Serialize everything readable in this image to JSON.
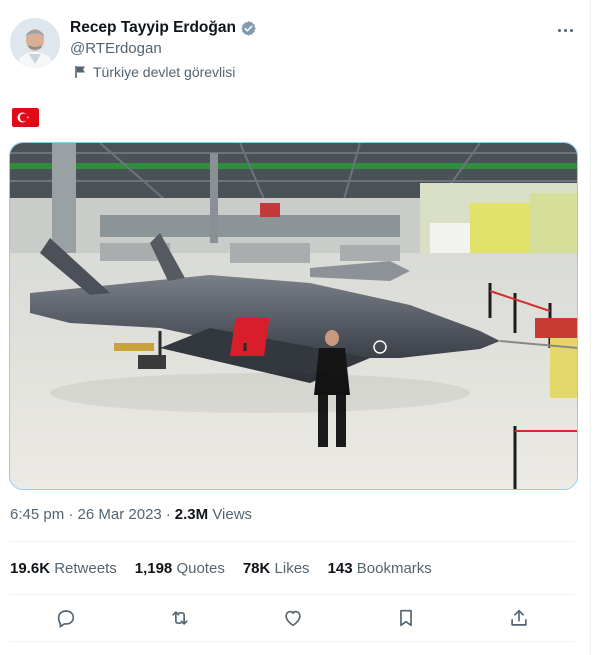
{
  "author": {
    "name": "Recep Tayyip Erdoğan",
    "handle": "@RTErdogan",
    "affiliation": "Türkiye devlet görevlisi"
  },
  "tweet": {
    "text_icon": "turkey-flag-emoji"
  },
  "timeline": {
    "time": "6:45 pm",
    "separator": "·",
    "date": "26 Mar 2023",
    "separator2": "·",
    "views_count": "2.3M",
    "views_label": "Views"
  },
  "stats": {
    "retweets_count": "19.6K",
    "retweets_label": "Retweets",
    "quotes_count": "1,198",
    "quotes_label": "Quotes",
    "likes_count": "78K",
    "likes_label": "Likes",
    "bookmarks_count": "143",
    "bookmarks_label": "Bookmarks"
  },
  "colors": {
    "accent": "#1d9bf0",
    "flag_red": "#e30a17",
    "muted_text": "#536471"
  },
  "icons": [
    "verified-badge-icon",
    "government-flag-icon",
    "more-icon",
    "reply-icon",
    "retweet-icon",
    "like-icon",
    "bookmark-icon",
    "share-icon"
  ]
}
